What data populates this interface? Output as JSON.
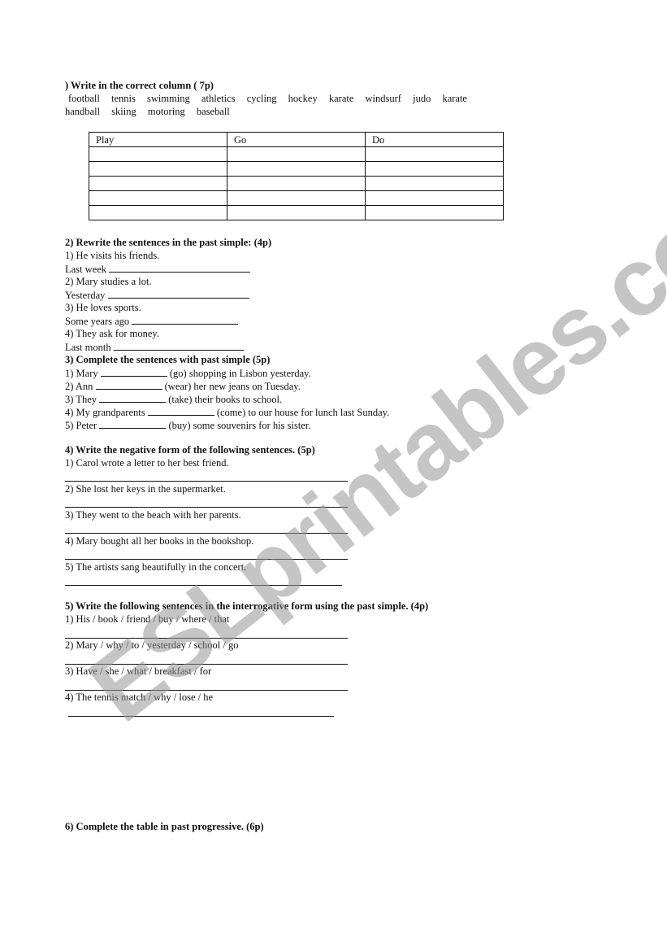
{
  "section1": {
    "heading": ") Write in the correct column ( 7p)",
    "words_line1": [
      "football",
      "tennis",
      "swimming",
      "athletics",
      "cycling",
      "hockey",
      "karate",
      "windsurf",
      "judo",
      "karate"
    ],
    "words_line2": [
      "handball",
      "skiing",
      "motoring",
      "baseball"
    ],
    "table_headers": [
      "Play",
      "Go",
      "Do"
    ],
    "empty_rows": 5
  },
  "section2": {
    "heading": "2) Rewrite the sentences in the past simple:  (4p)",
    "items": [
      {
        "sentence": "1) He visits his friends.",
        "prompt": "Last week"
      },
      {
        "sentence": "2) Mary studies a lot.",
        "prompt": "Yesterday"
      },
      {
        "sentence": "3) He loves sports.",
        "prompt": "Some years ago"
      },
      {
        "sentence": "4) They ask for money.",
        "prompt": "Last month"
      }
    ]
  },
  "section3": {
    "heading": "3) Complete the sentences with past simple  (5p)",
    "items": [
      {
        "start": "1) Mary",
        "end": "(go) shopping in Lisbon yesterday."
      },
      {
        "start": "2) Ann",
        "end": "(wear) her new jeans on Tuesday."
      },
      {
        "start": "3) They",
        "end": "(take) their books to school."
      },
      {
        "start": "4) My grandparents",
        "end": "(come) to our house for lunch last Sunday."
      },
      {
        "start": "5) Peter",
        "end": "(buy) some souvenirs for his sister."
      }
    ]
  },
  "section4": {
    "heading": "4) Write the negative form of the following sentences. (5p)",
    "items": [
      "1) Carol wrote a letter to her best friend.",
      "2) She lost her keys in the supermarket.",
      "3) They went to the beach with her parents.",
      "4) Mary bought all her books in the bookshop.",
      "5) The artists sang beautifully in the concert."
    ]
  },
  "section5": {
    "heading": "5) Write the following sentences in the interrogative form using the past simple. (4p)",
    "items": [
      "1) His / book / friend / buy / where / that",
      "2) Mary / why / to / yesterday / school / go",
      "3) Have / she / what / breakfast / for",
      "4) The tennis match / why / lose / he"
    ]
  },
  "section6": {
    "heading": "6) Complete the table in past progressive. (6p)"
  },
  "watermark": "ESLprintables.com"
}
